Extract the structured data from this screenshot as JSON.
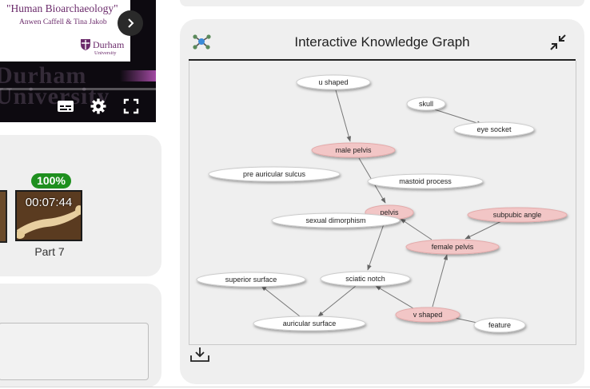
{
  "video": {
    "slide_title": "\"Human Bioarchaeology\"",
    "slide_authors": "Anwen Caffell & Tina Jakob",
    "logo_name": "Durham",
    "logo_sub": "University",
    "bg_text": "Durham University",
    "controls": [
      "subtitles-icon",
      "settings-icon",
      "fullscreen-icon"
    ]
  },
  "thumbnails": {
    "badge": "100%",
    "time": "00:07:44",
    "label": "Part 7"
  },
  "knowledge_graph": {
    "title": "Interactive Knowledge Graph",
    "highlight_color": "#f2c6c6",
    "nodes": [
      {
        "id": "u_shaped",
        "label": "u shaped",
        "highlight": false
      },
      {
        "id": "skull",
        "label": "skull",
        "highlight": false
      },
      {
        "id": "eye_socket",
        "label": "eye socket",
        "highlight": false
      },
      {
        "id": "male_pelvis",
        "label": "male pelvis",
        "highlight": true
      },
      {
        "id": "pre_auricular",
        "label": "pre auricular sulcus",
        "highlight": false
      },
      {
        "id": "mastoid",
        "label": "mastoid process",
        "highlight": false
      },
      {
        "id": "pelvis",
        "label": "pelvis",
        "highlight": true
      },
      {
        "id": "subpubic",
        "label": "subpubic angle",
        "highlight": true
      },
      {
        "id": "sexual_dimorphism",
        "label": "sexual dimorphism",
        "highlight": false
      },
      {
        "id": "female_pelvis",
        "label": "female pelvis",
        "highlight": true
      },
      {
        "id": "superior_surface",
        "label": "superior surface",
        "highlight": false
      },
      {
        "id": "sciatic_notch",
        "label": "sciatic notch",
        "highlight": false
      },
      {
        "id": "v_shaped",
        "label": "v shaped",
        "highlight": true
      },
      {
        "id": "auricular_surface",
        "label": "auricular surface",
        "highlight": false
      },
      {
        "id": "feature",
        "label": "feature",
        "highlight": false
      }
    ]
  }
}
